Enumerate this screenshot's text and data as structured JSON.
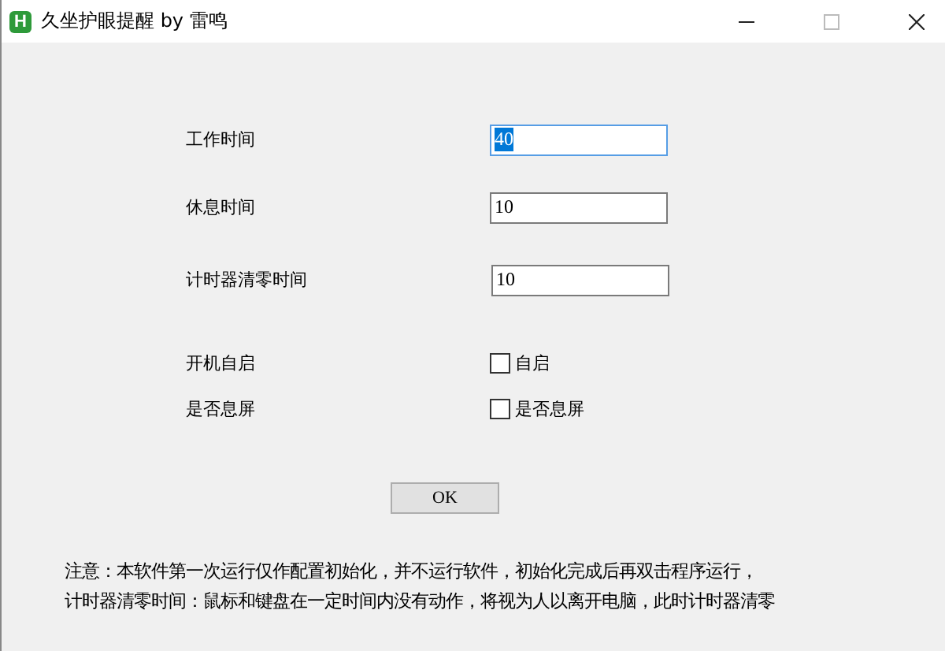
{
  "window": {
    "title": "久坐护眼提醒 by 雷鸣",
    "icon_letter": "H"
  },
  "fields": [
    {
      "label": "工作时间",
      "value": "40",
      "text_selected": true
    },
    {
      "label": "休息时间",
      "value": "10",
      "text_selected": false
    },
    {
      "label": "计时器清零时间",
      "value": "10",
      "text_selected": false
    }
  ],
  "options": [
    {
      "label": "开机自启",
      "checkbox_label": "自启",
      "checked": false
    },
    {
      "label": "是否息屏",
      "checkbox_label": "是否息屏",
      "checked": false
    }
  ],
  "ok_button": "OK",
  "notes": [
    "注意：本软件第一次运行仅作配置初始化，并不运行软件，初始化完成后再双击程序运行，",
    "计时器清零时间：鼠标和键盘在一定时间内没有动作，将视为人以离开电脑，此时计时器清零"
  ]
}
